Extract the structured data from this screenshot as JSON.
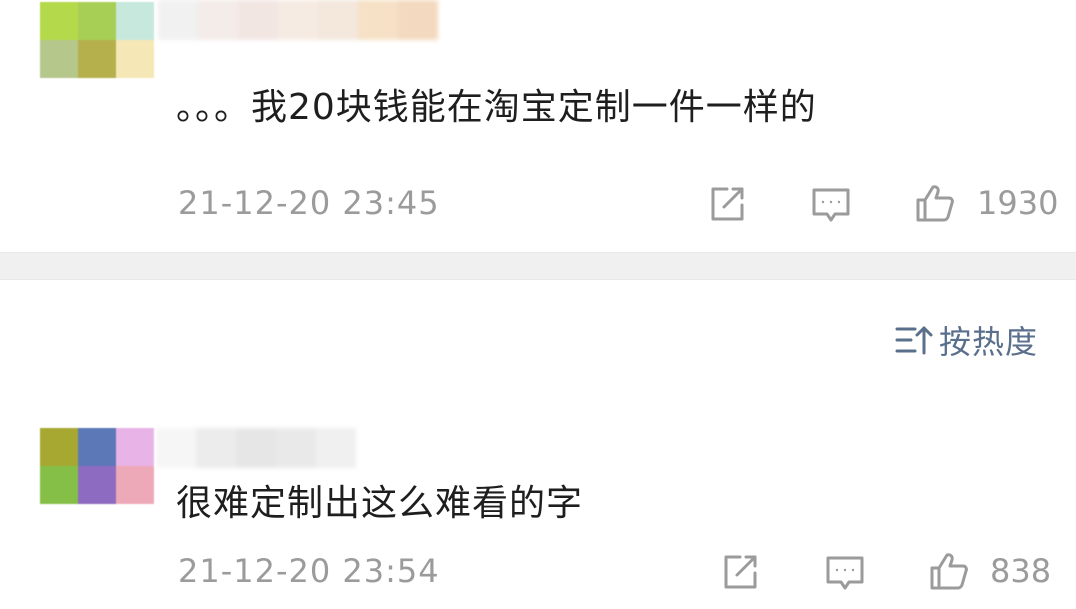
{
  "comments": [
    {
      "text": "。。。我20块钱能在淘宝定制一件一样的",
      "timestamp": "21-12-20 23:45",
      "likes": "1930",
      "avatar_colors": [
        "#b4d94a",
        "#a8cf55",
        "#c7e8dc",
        "#b6c78b",
        "#b5b04c",
        "#f6e7b6",
        "#ffffff",
        "#ffffff",
        "#ffffff"
      ],
      "username_blur_colors": [
        "#f1f1f1",
        "#f4ece8",
        "#f2e6e2",
        "#f6ebe3",
        "#f4e7dc",
        "#f6e1c6",
        "#f3d9bf"
      ]
    },
    {
      "text": "很难定制出这么难看的字",
      "timestamp": "21-12-20 23:54",
      "likes": "838",
      "avatar_colors": [
        "#a6a832",
        "#5c78b6",
        "#e8b3e6",
        "#86bf47",
        "#8c6bc0",
        "#eea9b9",
        "#ffffff",
        "#ffffff",
        "#ffffff"
      ],
      "username_blur_colors": [
        "#f6f6f6",
        "#ececec",
        "#e6e6e6",
        "#e9e9e9",
        "#f0f0f0"
      ]
    }
  ],
  "sort": {
    "label": "按热度",
    "icon": "sort-hot-icon"
  },
  "icons": {
    "share": "share-icon",
    "reply": "comment-icon",
    "like": "thumbs-up-icon"
  },
  "colors": {
    "text_primary": "#1e1e1e",
    "text_meta": "#9b9b9b",
    "sort_accent": "#5a6f8c",
    "separator": "#f0f0f0"
  }
}
